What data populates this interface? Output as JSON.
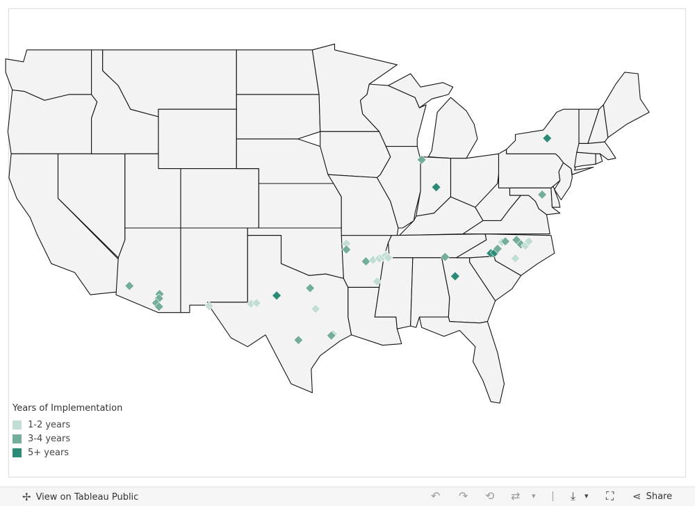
{
  "legend": {
    "title": "Years of Implementation",
    "items": [
      {
        "label": "1-2 years",
        "color": "#c2ddd5"
      },
      {
        "label": "3-4 years",
        "color": "#75ad9d"
      },
      {
        "label": "5+ years",
        "color": "#2c8a77"
      }
    ]
  },
  "map": {
    "fill": "#f3f3f3",
    "stroke": "#111111",
    "background": "#ffffff",
    "sites": [
      {
        "lat": 33.1,
        "lon": -113.6,
        "years": "3-4 years"
      },
      {
        "lat": 32.55,
        "lon": -110.9,
        "years": "3-4 years"
      },
      {
        "lat": 32.25,
        "lon": -110.95,
        "years": "3-4 years"
      },
      {
        "lat": 31.95,
        "lon": -111.2,
        "years": "3-4 years"
      },
      {
        "lat": 31.7,
        "lon": -110.95,
        "years": "3-4 years"
      },
      {
        "lat": 31.75,
        "lon": -106.45,
        "years": "1-2 years"
      },
      {
        "lat": 31.9,
        "lon": -102.7,
        "years": "1-2 years"
      },
      {
        "lat": 31.95,
        "lon": -102.2,
        "years": "1-2 years"
      },
      {
        "lat": 32.45,
        "lon": -100.4,
        "years": "5+ years"
      },
      {
        "lat": 32.95,
        "lon": -97.4,
        "years": "3-4 years"
      },
      {
        "lat": 31.55,
        "lon": -96.9,
        "years": "1-2 years"
      },
      {
        "lat": 29.45,
        "lon": -98.45,
        "years": "3-4 years"
      },
      {
        "lat": 29.85,
        "lon": -95.35,
        "years": "1-2 years"
      },
      {
        "lat": 29.75,
        "lon": -95.5,
        "years": "3-4 years"
      },
      {
        "lat": 35.95,
        "lon": -94.15,
        "years": "1-2 years"
      },
      {
        "lat": 35.55,
        "lon": -94.15,
        "years": "3-4 years"
      },
      {
        "lat": 34.75,
        "lon": -92.4,
        "years": "3-4 years"
      },
      {
        "lat": 34.85,
        "lon": -91.75,
        "years": "1-2 years"
      },
      {
        "lat": 34.95,
        "lon": -91.2,
        "years": "1-2 years"
      },
      {
        "lat": 35.05,
        "lon": -90.85,
        "years": "1-2 years"
      },
      {
        "lat": 35.15,
        "lon": -90.6,
        "years": "1-2 years"
      },
      {
        "lat": 35.0,
        "lon": -90.4,
        "years": "1-2 years"
      },
      {
        "lat": 33.4,
        "lon": -91.4,
        "years": "1-2 years"
      },
      {
        "lat": 41.6,
        "lon": -87.4,
        "years": "3-4 years"
      },
      {
        "lat": 39.75,
        "lon": -86.1,
        "years": "5+ years"
      },
      {
        "lat": 35.05,
        "lon": -85.3,
        "years": "3-4 years"
      },
      {
        "lat": 33.75,
        "lon": -84.4,
        "years": "5+ years"
      },
      {
        "lat": 43.05,
        "lon": -76.15,
        "years": "5+ years"
      },
      {
        "lat": 39.25,
        "lon": -76.6,
        "years": "3-4 years"
      },
      {
        "lat": 35.3,
        "lon": -81.2,
        "years": "5+ years"
      },
      {
        "lat": 35.35,
        "lon": -80.85,
        "years": "5+ years"
      },
      {
        "lat": 35.6,
        "lon": -80.6,
        "years": "3-4 years"
      },
      {
        "lat": 36.05,
        "lon": -80.2,
        "years": "1-2 years"
      },
      {
        "lat": 36.1,
        "lon": -79.9,
        "years": "3-4 years"
      },
      {
        "lat": 36.2,
        "lon": -78.9,
        "years": "3-4 years"
      },
      {
        "lat": 35.9,
        "lon": -78.5,
        "years": "3-4 years"
      },
      {
        "lat": 35.8,
        "lon": -78.1,
        "years": "1-2 years"
      },
      {
        "lat": 36.1,
        "lon": -77.8,
        "years": "1-2 years"
      },
      {
        "lat": 34.95,
        "lon": -79.0,
        "years": "1-2 years"
      }
    ]
  },
  "toolbar": {
    "view_label": "View on Tableau Public",
    "share_label": "Share"
  }
}
